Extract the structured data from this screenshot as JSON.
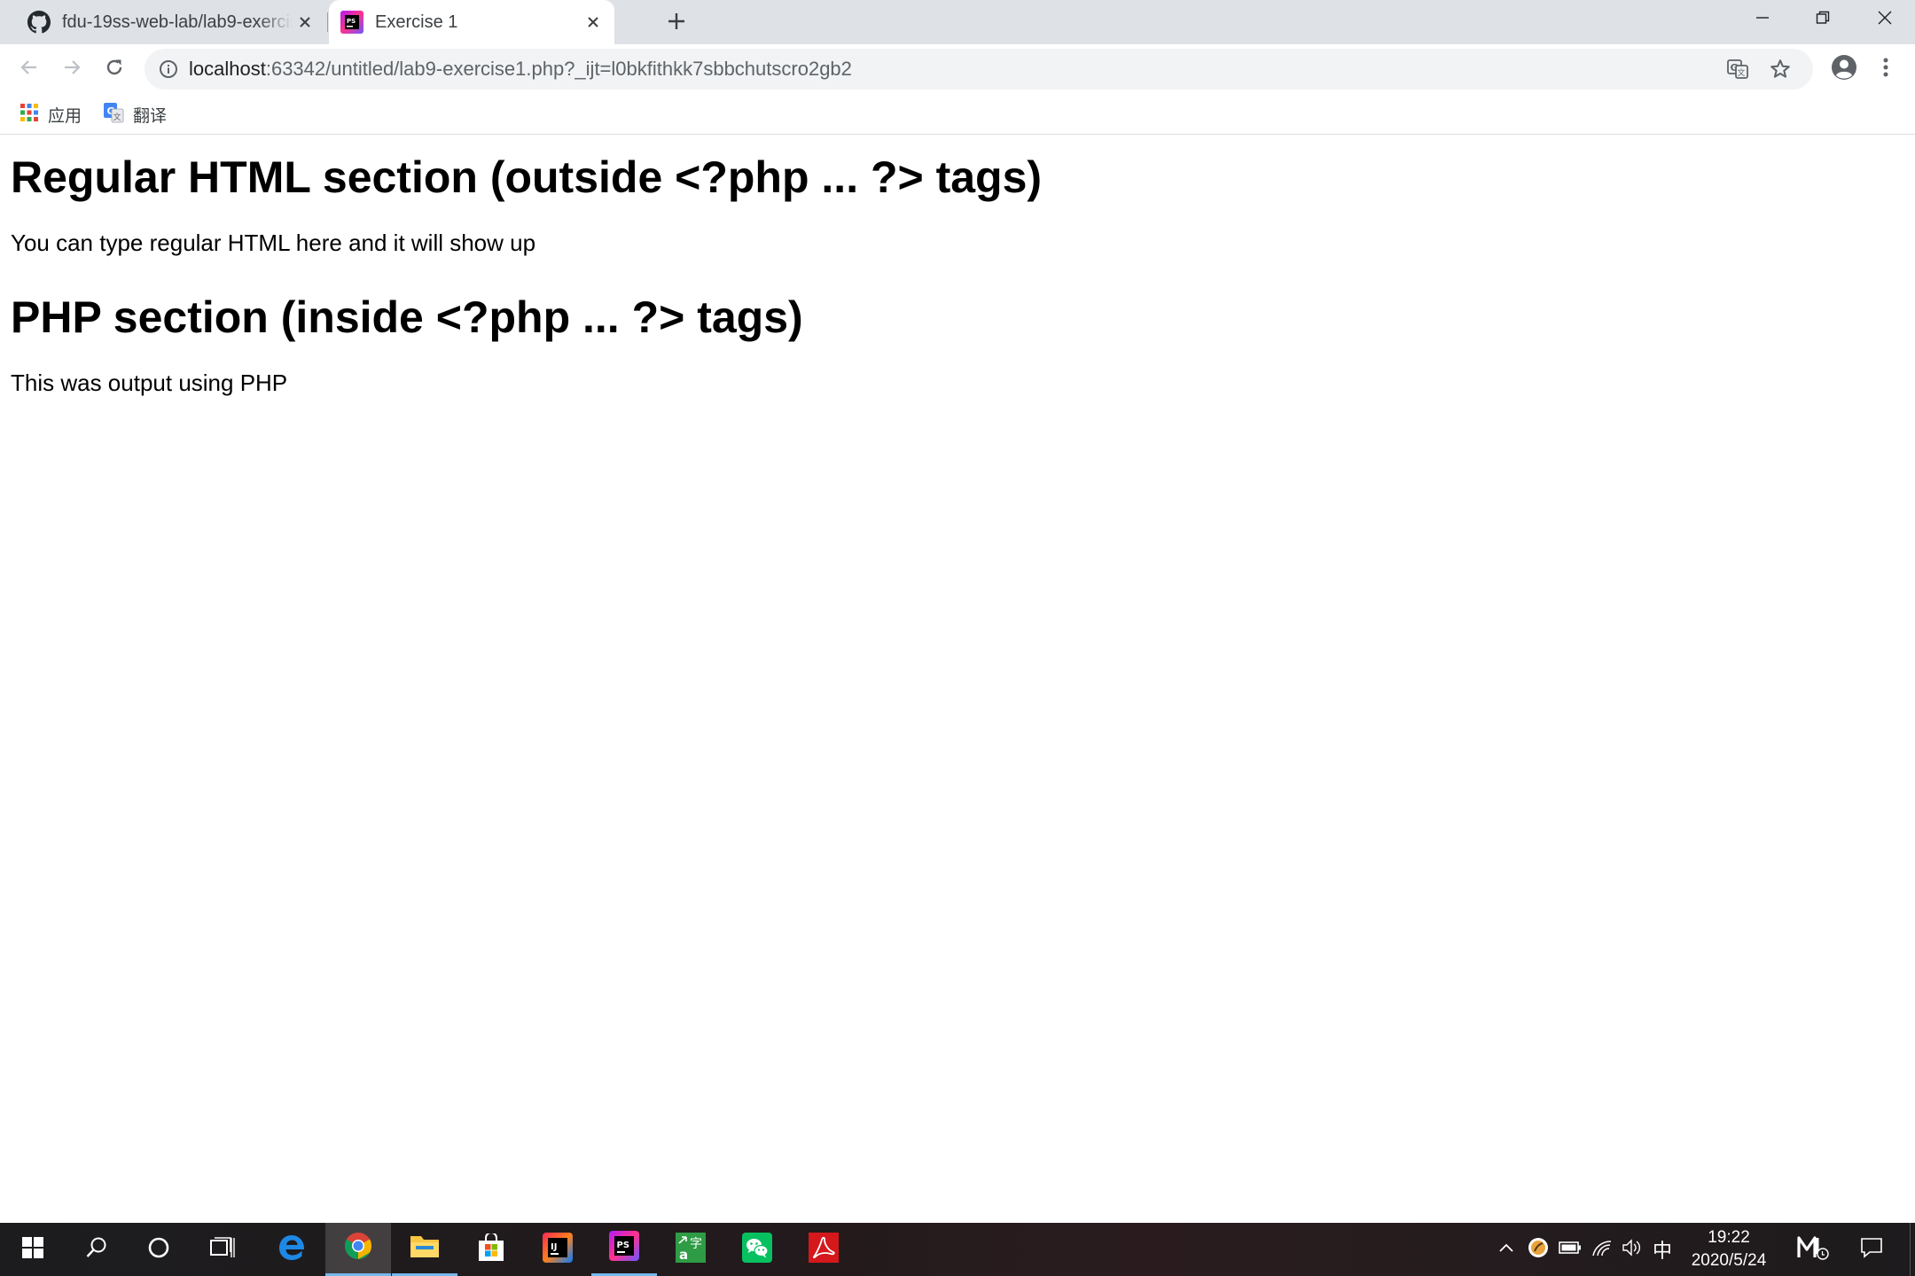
{
  "browser": {
    "tabs": [
      {
        "title": "fdu-19ss-web-lab/lab9-exercise",
        "icon": "github-icon",
        "active": false
      },
      {
        "title": "Exercise 1",
        "icon": "phpstorm-icon",
        "active": true
      }
    ],
    "address": {
      "host": "localhost",
      "rest": ":63342/untitled/lab9-exercise1.php?_ijt=l0bkfithkk7sbbchutscro2gb2"
    },
    "bookmarks": [
      {
        "label": "应用",
        "icon": "apps-grid-icon"
      },
      {
        "label": "翻译",
        "icon": "google-translate-icon"
      }
    ]
  },
  "page": {
    "heading_html": "Regular HTML section (outside <?php ... ?> tags)",
    "paragraph_html": "You can type regular HTML here and it will show up",
    "heading_php": "PHP section (inside <?php ... ?> tags)",
    "paragraph_php": "This was output using PHP"
  },
  "taskbar": {
    "apps": [
      {
        "name": "edge",
        "icon": "edge-icon"
      },
      {
        "name": "chrome",
        "icon": "chrome-icon",
        "active": true
      },
      {
        "name": "file-explorer",
        "icon": "folder-icon"
      },
      {
        "name": "store",
        "icon": "store-icon"
      },
      {
        "name": "intellij",
        "icon": "intellij-icon"
      },
      {
        "name": "phpstorm",
        "icon": "phpstorm-icon",
        "running": true
      },
      {
        "name": "dictionary",
        "icon": "dictionary-icon"
      },
      {
        "name": "wechat",
        "icon": "wechat-icon"
      },
      {
        "name": "acrobat",
        "icon": "acrobat-icon"
      }
    ],
    "ime": "中",
    "time": "19:22",
    "date": "2020/5/24"
  },
  "colors": {
    "tabstrip": "#dee1e6",
    "omnibox": "#f1f3f4",
    "taskbar_accent": "#76b9ed"
  }
}
